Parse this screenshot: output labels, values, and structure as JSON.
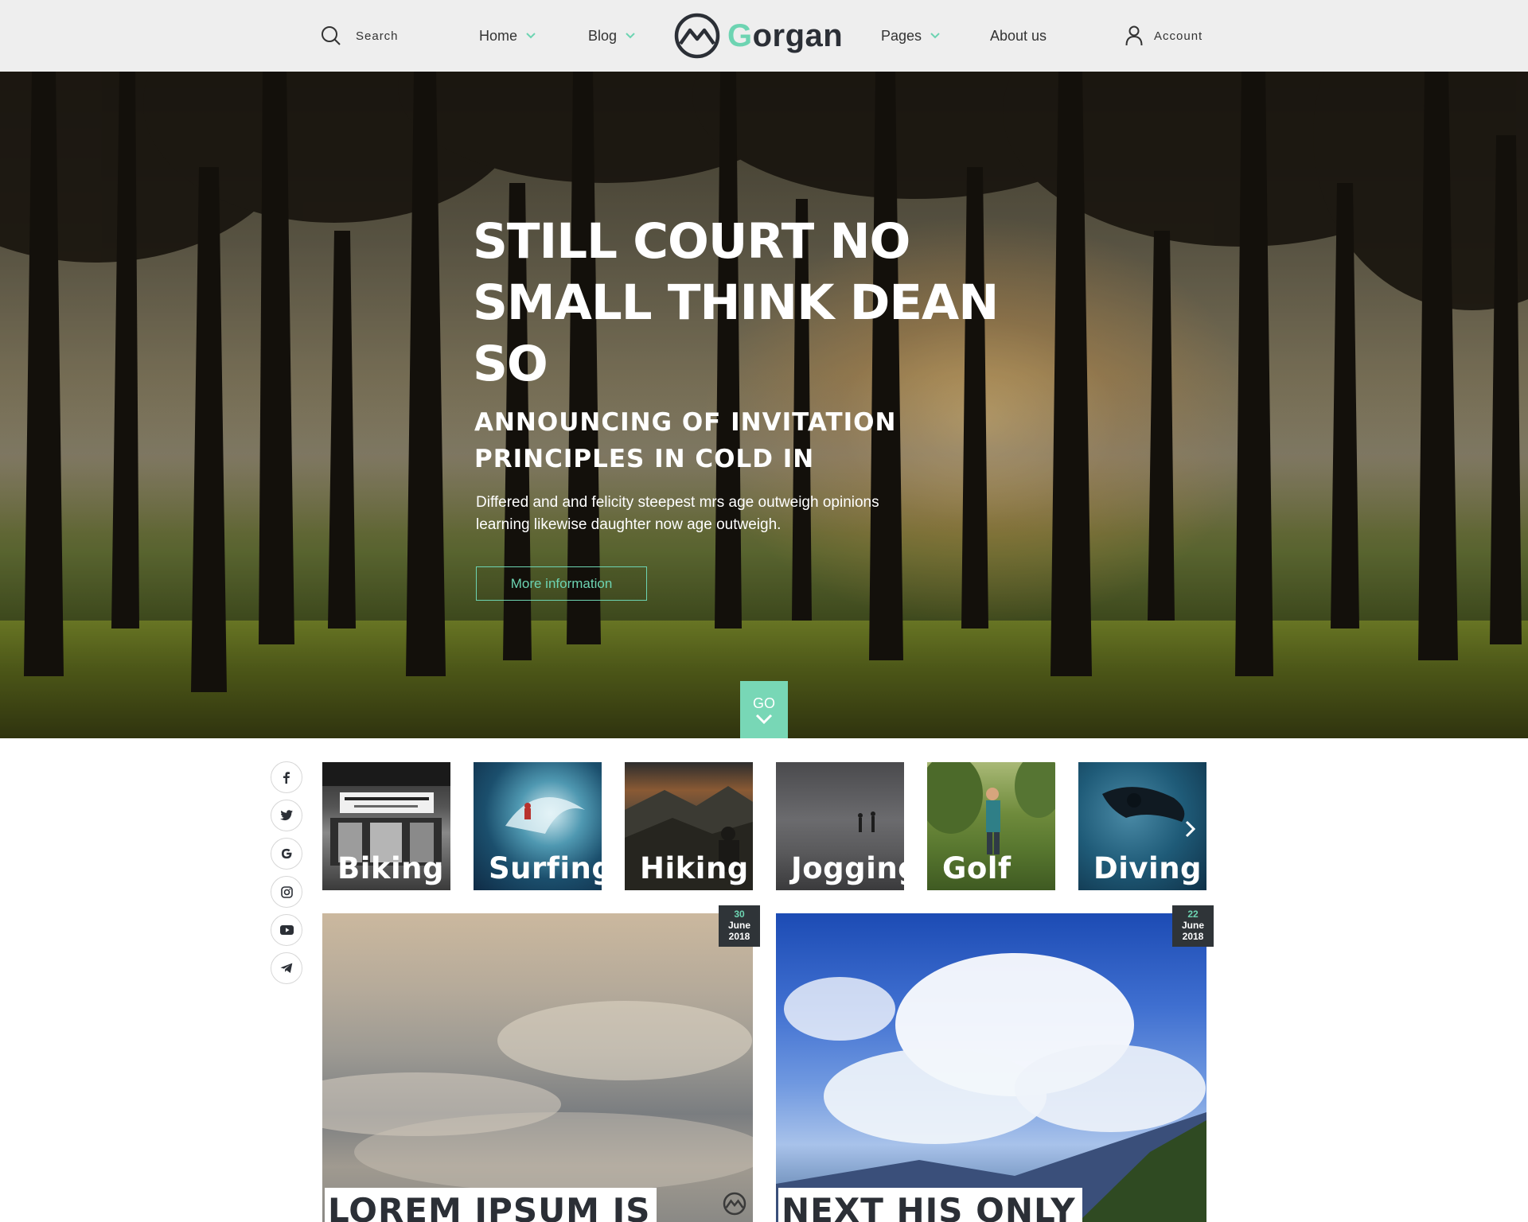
{
  "header": {
    "search_label": "Search",
    "nav": [
      {
        "label": "Home",
        "has_dropdown": true
      },
      {
        "label": "Blog",
        "has_dropdown": true
      },
      {
        "label": "Pages",
        "has_dropdown": true
      },
      {
        "label": "About us",
        "has_dropdown": false
      }
    ],
    "logo_first_letter": "G",
    "logo_rest": "organ",
    "account_label": "Account"
  },
  "hero": {
    "title_lines": [
      "STILL COURT NO",
      "SMALL THINK DEAN",
      "SO"
    ],
    "subtitle_lines": [
      "ANNOUNCING OF INVITATION",
      "PRINCIPLES IN COLD IN"
    ],
    "description_lines": [
      "Differed and and felicity steepest mrs age outweigh opinions",
      "learning likewise daughter now age outweigh."
    ],
    "cta_label": "More information",
    "go_label": "GO"
  },
  "social": [
    "facebook-icon",
    "twitter-icon",
    "google-icon",
    "instagram-icon",
    "youtube-icon",
    "telegram-icon"
  ],
  "categories": [
    {
      "label": "Biking",
      "icon": "biking-thumbnail"
    },
    {
      "label": "Surfing",
      "icon": "surfing-thumbnail"
    },
    {
      "label": "Hiking",
      "icon": "hiking-thumbnail"
    },
    {
      "label": "Jogging",
      "icon": "jogging-thumbnail"
    },
    {
      "label": "Golf",
      "icon": "golf-thumbnail"
    },
    {
      "label": "Diving",
      "icon": "diving-thumbnail"
    }
  ],
  "posts": [
    {
      "day": "30",
      "month": "June",
      "year": "2018",
      "title": "LOREM IPSUM IS"
    },
    {
      "day": "22",
      "month": "June",
      "year": "2018",
      "title": "NEXT HIS ONLY"
    }
  ],
  "colors": {
    "accent": "#6dd4b2",
    "header_bg": "#eeeeee",
    "text_dark": "#2b2f36",
    "date_badge": "#2f3438"
  }
}
